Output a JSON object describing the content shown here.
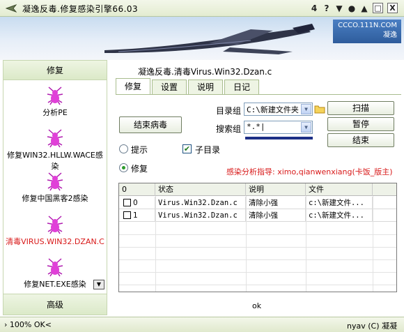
{
  "window": {
    "title": "凝逸反毒.修复感染引擎66.03",
    "controls": [
      "4",
      "?",
      "▼",
      "●",
      "▲",
      "□",
      "X"
    ]
  },
  "banner": {
    "logo_url_text": "CCCO.111N.COM",
    "logo_name": "凝逸"
  },
  "sidebar": {
    "header": "修复",
    "items": [
      {
        "label": "分析PE",
        "icon": "spider-icon"
      },
      {
        "label": "修复WIN32.HLLW.WACE感染",
        "icon": "spider-icon"
      },
      {
        "label": "修复中国黑客2感染",
        "icon": "spider-icon"
      },
      {
        "label": "清毒VIRUS.WIN32.DZAN.C",
        "icon": "spider-icon",
        "active": true
      },
      {
        "label": "修复NET.EXE感染",
        "icon": "spider-icon"
      }
    ],
    "footer": "高级",
    "colors": {
      "active_text": "#d81818",
      "spider": "#e040d8"
    }
  },
  "main": {
    "heading": "凝逸反毒.清毒Virus.Win32.Dzan.c",
    "tabs": [
      {
        "label": "修复",
        "active": true
      },
      {
        "label": "设置"
      },
      {
        "label": "说明"
      },
      {
        "label": "日记"
      }
    ],
    "kill_button": "结束病毒",
    "dir_label": "目录组",
    "dir_value": "C:\\新建文件夹",
    "search_label": "搜索组",
    "search_value": "*.*|",
    "scan_button": "扫描",
    "pause_button": "暂停",
    "end_button": "结束",
    "radio_prompt": "提示",
    "check_subdir": "子目录",
    "radio_repair": "修复",
    "hint_text": "感染分析指导: ximo,qianwenxiang(卡饭_版主)"
  },
  "table": {
    "columns": [
      "0",
      "状态",
      "说明",
      "文件"
    ],
    "rows": [
      {
        "id": "0",
        "status": "Virus.Win32.Dzan.c",
        "desc": "清除小强",
        "file": "c:\\新建文件..."
      },
      {
        "id": "1",
        "status": "Virus.Win32.Dzan.c",
        "desc": "清除小强",
        "file": "c:\\新建文件..."
      }
    ]
  },
  "status_mid": "ok",
  "statusbar": {
    "left": "100% OK<",
    "right": "nyav (C) 凝凝"
  }
}
